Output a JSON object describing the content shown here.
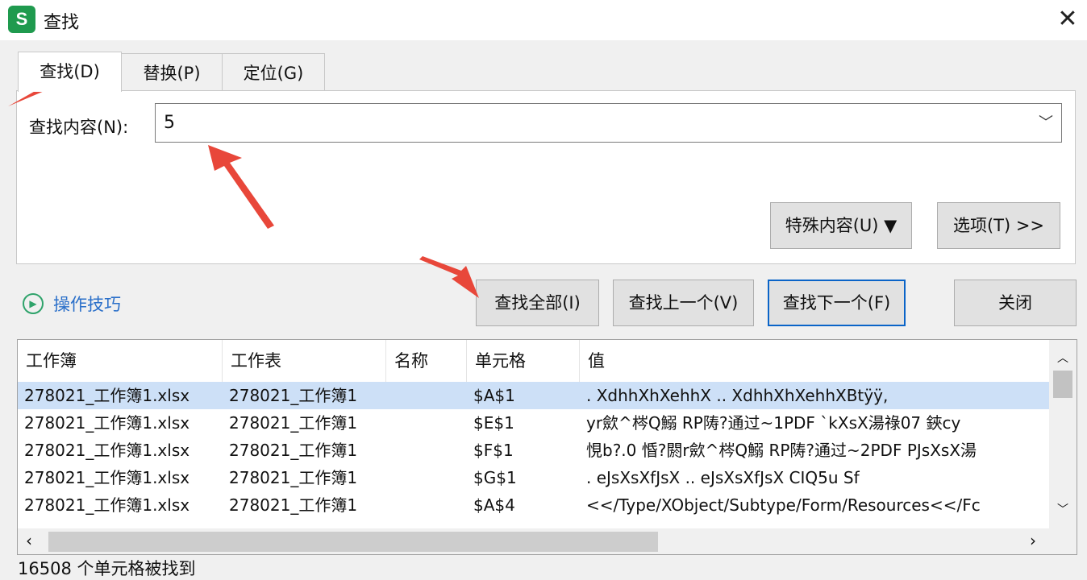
{
  "window": {
    "title": "查找",
    "app_icon_letter": "S",
    "close": "✕"
  },
  "tabs": [
    {
      "label": "查找(D)"
    },
    {
      "label": "替换(P)"
    },
    {
      "label": "定位(G)"
    }
  ],
  "find": {
    "label": "查找内容(N):",
    "value": "5"
  },
  "buttons": {
    "special": "特殊内容(U) ▼",
    "options": "选项(T) >>",
    "find_all": "查找全部(I)",
    "find_prev": "查找上一个(V)",
    "find_next": "查找下一个(F)",
    "close": "关闭"
  },
  "tips_link": "操作技巧",
  "table": {
    "columns": [
      "工作簿",
      "工作表",
      "名称",
      "单元格",
      "值"
    ],
    "rows": [
      [
        "278021_工作簿1.xlsx",
        "278021_工作簿1",
        "",
        "$A$1",
        ".          XdhhXhXehhX ..          XdhhXhXehhXBtÿÿ,"
      ],
      [
        "278021_工作簿1.xlsx",
        "278021_工作簿1",
        "",
        "$E$1",
        "yr歛^梣Q鰯 RP陦?通过~1PDF     `kXsX湯祿07  鋏cy"
      ],
      [
        "278021_工作簿1.xlsx",
        "278021_工作簿1",
        "",
        "$F$1",
        "悓b?.0 惛?閼r歛^梣Q鰯 RP陦?通过~2PDF  PJsXsX湯"
      ],
      [
        "278021_工作簿1.xlsx",
        "278021_工作簿1",
        "",
        "$G$1",
        ".            eJsXsXfJsX ..            eJsXsXfJsX CIQ5u Sf"
      ],
      [
        "278021_工作簿1.xlsx",
        "278021_工作簿1",
        "",
        "$A$4",
        "<</Type/XObject/Subtype/Form/Resources<</Fc"
      ]
    ]
  },
  "status": "16508 个单元格被找到",
  "colors": {
    "accent": "#0a64c8",
    "link": "#2a6fc9",
    "selection": "#cde0f7",
    "annotation_arrow": "#e8473a"
  }
}
